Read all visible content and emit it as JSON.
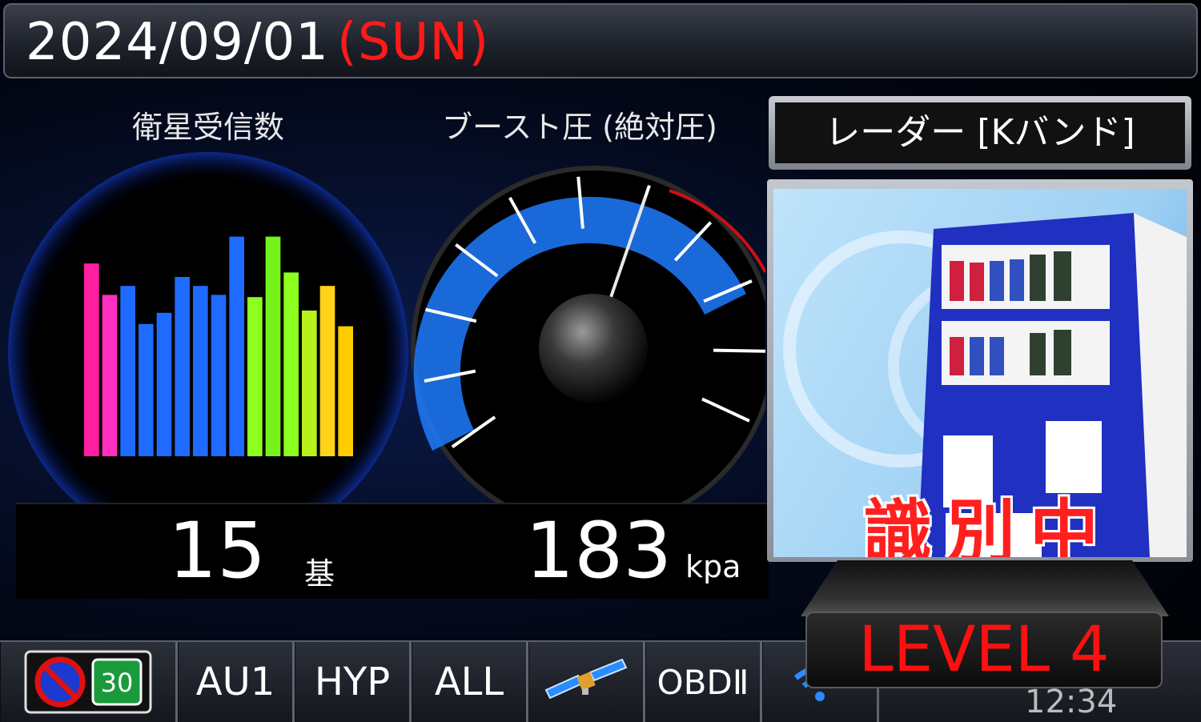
{
  "header": {
    "date": "2024/09/01",
    "weekday": "(SUN)"
  },
  "satellite": {
    "title": "衛星受信数",
    "count": "15",
    "unit": "基",
    "bar_levels": [
      0.86,
      0.72,
      0.76,
      0.59,
      0.64,
      0.8,
      0.76,
      0.72,
      0.98,
      0.71,
      0.98,
      0.82,
      0.65,
      0.76,
      0.58
    ],
    "bar_colors": [
      "#ff1fa2",
      "#ff2fbf",
      "#1f6bff",
      "#1f6bff",
      "#1f6bff",
      "#1f6bff",
      "#1f6bff",
      "#1f6bff",
      "#1f6bff",
      "#8cff1f",
      "#74f21a",
      "#8cff1f",
      "#b8f21a",
      "#ffd21a",
      "#ffcc00"
    ]
  },
  "boost": {
    "title": "ブースト圧 (絶対圧)",
    "value": "183",
    "unit": "kpa",
    "needle_fraction": 0.6
  },
  "radar": {
    "title": "レーダー [Kバンド]",
    "status": "識別中",
    "level": "LEVEL 4"
  },
  "bottom_bar": {
    "sign_speed": "30",
    "items": [
      "AU1",
      "HYP",
      "ALL",
      "satellite-icon",
      "OBDⅡ",
      "wifi-icon"
    ],
    "clock": "12:34"
  }
}
